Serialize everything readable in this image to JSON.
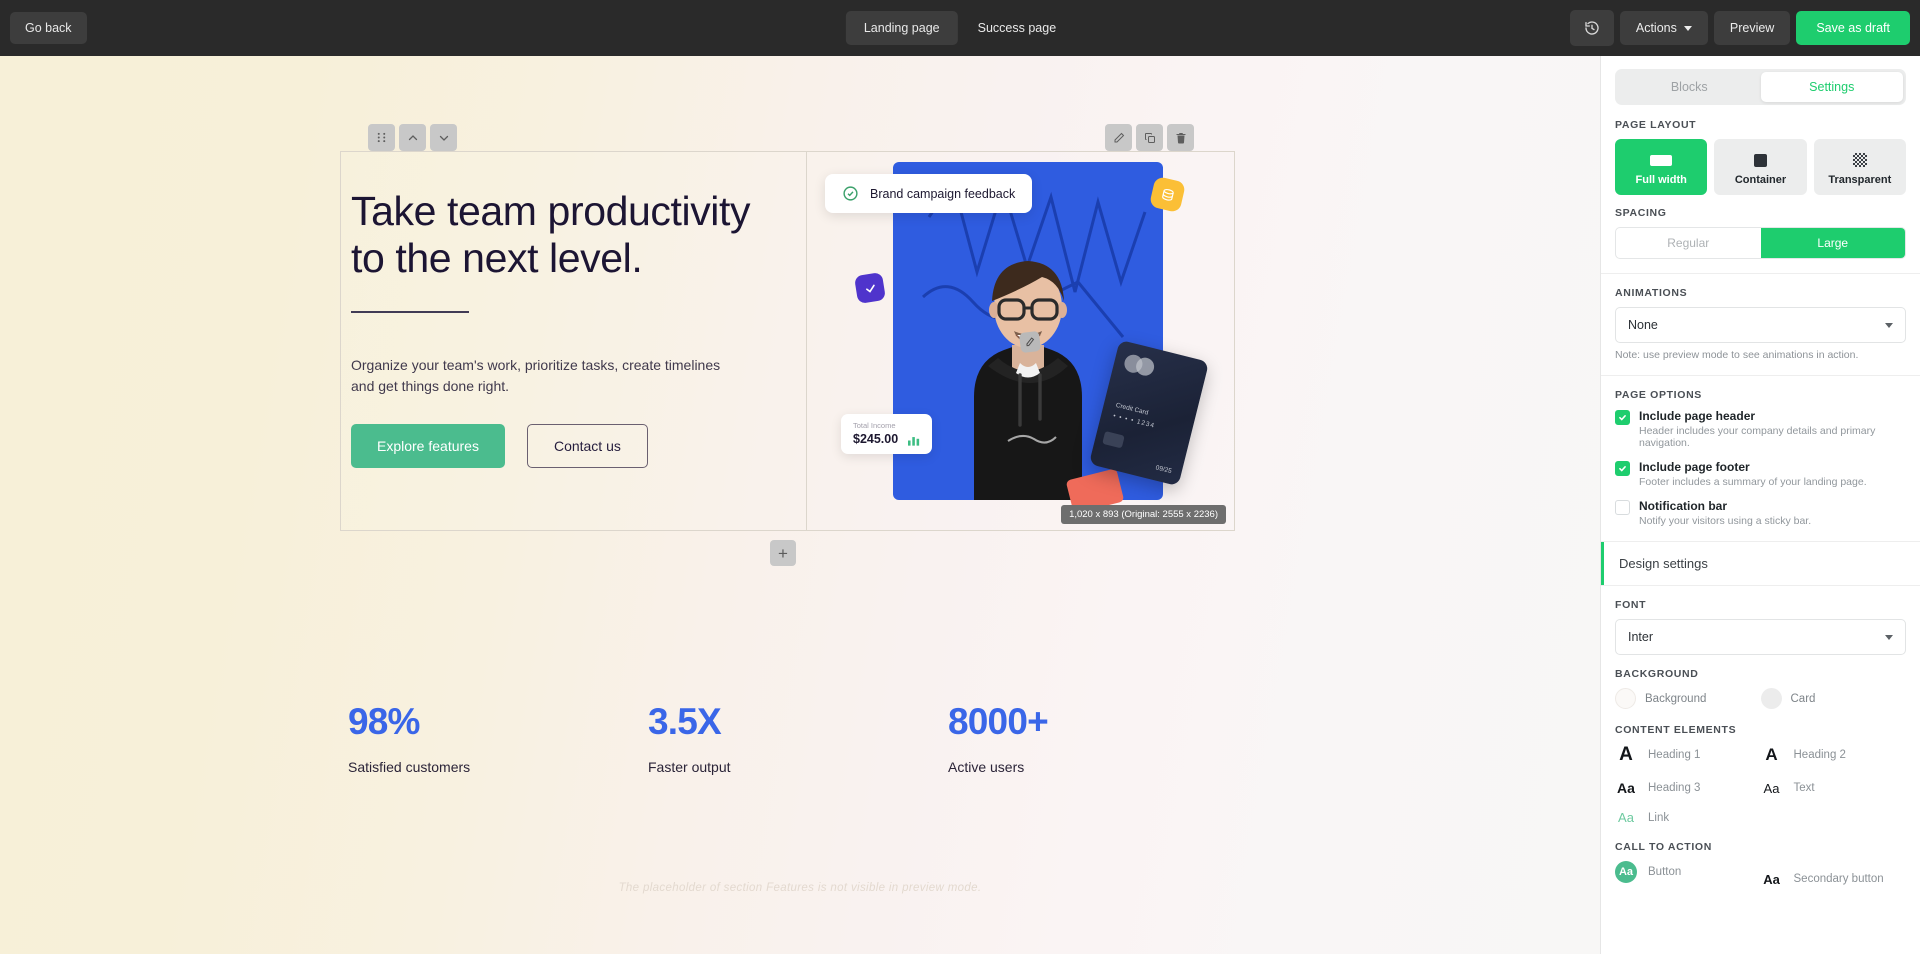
{
  "topbar": {
    "go_back": "Go back",
    "tabs": [
      {
        "label": "Landing page",
        "active": true
      },
      {
        "label": "Success page",
        "active": false
      }
    ],
    "history_icon": "history-revert-icon",
    "actions": "Actions",
    "preview": "Preview",
    "save_draft": "Save as draft",
    "primary_color": "#1ecd6e"
  },
  "canvas": {
    "block_tools_left": [
      "drag-handle-icon",
      "move-up-icon",
      "move-down-icon"
    ],
    "block_tools_right": [
      "edit-pencil-icon",
      "duplicate-icon",
      "delete-trash-icon"
    ],
    "hero": {
      "heading": "Take team productivity to the next level.",
      "subtext": "Organize your team's work, prioritize tasks, create timelines and get things done right.",
      "primary_cta": "Explore features",
      "secondary_cta": "Contact us"
    },
    "image_overlays": {
      "feedback_card": "Brand campaign feedback",
      "income_label": "Total Income",
      "income_amount": "$245.00",
      "credit_card_label": "Credit Card",
      "credit_card_number": "• • • •  1234",
      "credit_card_expiry": "09/25"
    },
    "dimension_badge": "1,020 x 893 (Original: 2555 x 2236)",
    "add_section": "+",
    "stats": [
      {
        "value": "98%",
        "label": "Satisfied customers"
      },
      {
        "value": "3.5X",
        "label": "Faster output"
      },
      {
        "value": "8000+",
        "label": "Active users"
      }
    ],
    "placeholder_note": "The placeholder of section Features is not visible in preview mode."
  },
  "panel": {
    "tabs": [
      {
        "label": "Blocks",
        "active": false
      },
      {
        "label": "Settings",
        "active": true
      }
    ],
    "page_layout": {
      "title": "PAGE LAYOUT",
      "options": [
        {
          "label": "Full width",
          "active": true,
          "icon": "full-width-icon"
        },
        {
          "label": "Container",
          "active": false,
          "icon": "container-icon"
        },
        {
          "label": "Transparent",
          "active": false,
          "icon": "transparent-icon"
        }
      ]
    },
    "spacing": {
      "title": "SPACING",
      "options": [
        {
          "label": "Regular",
          "active": false
        },
        {
          "label": "Large",
          "active": true
        }
      ]
    },
    "animations": {
      "title": "ANIMATIONS",
      "value": "None",
      "note": "Note: use preview mode to see animations in action."
    },
    "page_options": {
      "title": "PAGE OPTIONS",
      "items": [
        {
          "label": "Include page header",
          "desc": "Header includes your company details and primary navigation.",
          "checked": true
        },
        {
          "label": "Include page footer",
          "desc": "Footer includes a summary of your landing page.",
          "checked": true
        },
        {
          "label": "Notification bar",
          "desc": "Notify your visitors using a sticky bar.",
          "checked": false
        }
      ]
    },
    "design_settings": {
      "header": "Design settings",
      "font": {
        "title": "FONT",
        "value": "Inter"
      },
      "background": {
        "title": "BACKGROUND",
        "items": [
          {
            "label": "Background",
            "swatch": "#fbf9f7"
          },
          {
            "label": "Card",
            "swatch": "#ececec"
          }
        ]
      },
      "content_elements": {
        "title": "CONTENT ELEMENTS",
        "items": [
          {
            "glyph": "A",
            "label": "Heading 1"
          },
          {
            "glyph": "A",
            "label": "Heading 2"
          },
          {
            "glyph": "Aa",
            "label": "Heading 3"
          },
          {
            "glyph": "Aa",
            "label": "Text"
          },
          {
            "glyph": "Aa",
            "label": "Link"
          }
        ]
      },
      "call_to_action": {
        "title": "CALL TO ACTION",
        "items": [
          {
            "glyph": "Aa",
            "label": "Button"
          },
          {
            "glyph": "Aa",
            "label": "Secondary button"
          }
        ]
      }
    }
  }
}
